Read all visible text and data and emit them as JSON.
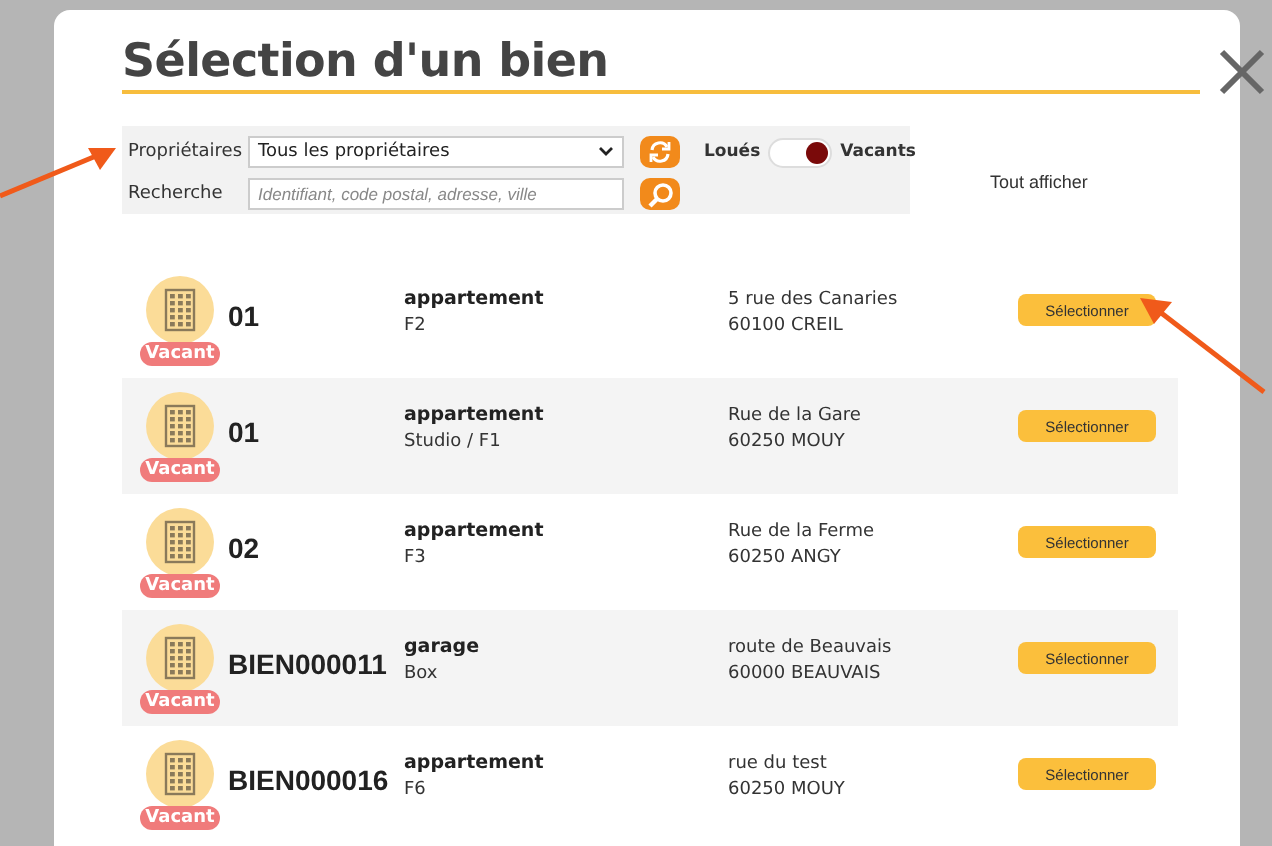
{
  "dialog": {
    "title": "Sélection d'un bien"
  },
  "filters": {
    "owner_label": "Propriétaires",
    "owner_value": "Tous les propriétaires",
    "search_label": "Recherche",
    "search_placeholder": "Identifiant, code postal, adresse, ville",
    "toggle": {
      "off_label": "Loués",
      "on_label": "Vacants",
      "on": true
    },
    "show_all": "Tout afficher"
  },
  "properties": [
    {
      "status": "Vacant",
      "id": "01",
      "type": "appartement",
      "size": "F2",
      "street": "5 rue des Canaries",
      "city": "60100 CREIL",
      "action": "Sélectionner"
    },
    {
      "status": "Vacant",
      "id": "01",
      "type": "appartement",
      "size": "Studio / F1",
      "street": "Rue de la Gare",
      "city": "60250 MOUY",
      "action": "Sélectionner"
    },
    {
      "status": "Vacant",
      "id": "02",
      "type": "appartement",
      "size": "F3",
      "street": "Rue de la Ferme",
      "city": "60250 ANGY",
      "action": "Sélectionner"
    },
    {
      "status": "Vacant",
      "id": "BIEN000011",
      "type": "garage",
      "size": "Box",
      "street": "route de Beauvais",
      "city": "60000 BEAUVAIS",
      "action": "Sélectionner"
    },
    {
      "status": "Vacant",
      "id": "BIEN000016",
      "type": "appartement",
      "size": "F6",
      "street": "rue du test",
      "city": "60250 MOUY",
      "action": "Sélectionner"
    }
  ]
}
